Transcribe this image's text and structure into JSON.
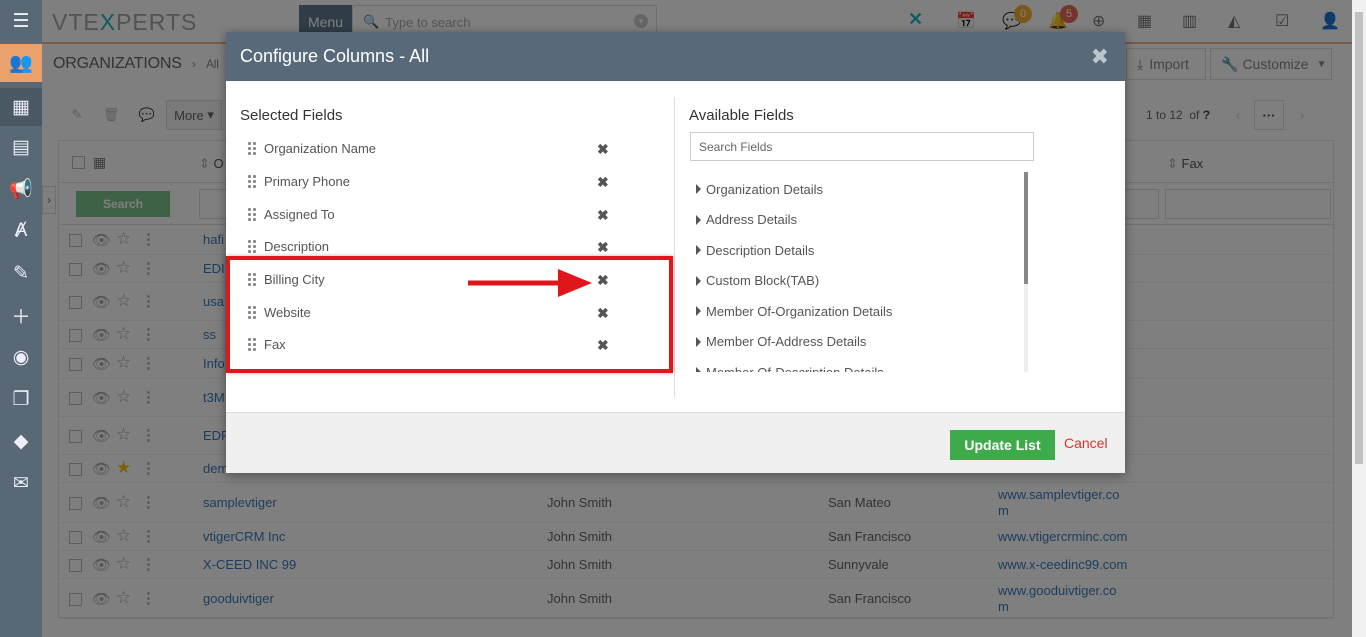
{
  "brand": {
    "logo_prefix": "VTE",
    "logo_x": "X",
    "logo_suffix": "PERTS"
  },
  "topbar": {
    "menu_label": "Menu",
    "search_placeholder": "Type to search",
    "chat_badge": "0",
    "notif_badge": "5",
    "icons": [
      "vtiger-x-icon",
      "tasks-icon",
      "chat-icon",
      "bell-icon",
      "plus-circle-icon",
      "calendar-icon",
      "bar-chart-icon",
      "area-chart-icon",
      "checkbox-icon",
      "user-icon"
    ]
  },
  "breadcrumb": {
    "module": "ORGANIZATIONS",
    "sep": "›",
    "filter": "All"
  },
  "header_buttons": {
    "import": "Import",
    "customize": "Customize"
  },
  "toolbar": {
    "more": "More",
    "pagination": "1 to 12",
    "of": "of",
    "total": "?",
    "dots": "···"
  },
  "list": {
    "columns_visible": [
      "O",
      "Fax"
    ],
    "search_label": "Search",
    "rows": [
      {
        "name": "hafi",
        "owner": "",
        "city": "",
        "website": "",
        "starred": false
      },
      {
        "name": "EDI",
        "owner": "",
        "city": "",
        "website": "",
        "starred": false
      },
      {
        "name": "usa",
        "owner": "",
        "city": "",
        "website": "",
        "starred": false
      },
      {
        "name": "ss",
        "owner": "",
        "city": "",
        "website": "",
        "starred": false
      },
      {
        "name": "Info",
        "owner": "",
        "city": "",
        "website": "",
        "starred": false
      },
      {
        "name": "t3M",
        "owner": "",
        "city": "",
        "website": "",
        "starred": false
      },
      {
        "name": "EDF",
        "owner": "",
        "city": "",
        "website": "",
        "starred": false
      },
      {
        "name": "dem",
        "owner": "",
        "city": "",
        "website": "",
        "starred": true
      },
      {
        "name": "samplevtiger",
        "owner": "John Smith",
        "city": "San Mateo",
        "website": "www.samplevtiger.co",
        "website2": "m",
        "starred": false
      },
      {
        "name": "vtigerCRM Inc",
        "owner": "John Smith",
        "city": "San Francisco",
        "website": "www.vtigercrminc.com",
        "starred": false
      },
      {
        "name": "X-CEED INC 99",
        "owner": "John Smith",
        "city": "Sunnyvale",
        "website": "www.x-ceedinc99.com",
        "starred": false
      },
      {
        "name": "gooduivtiger",
        "owner": "John Smith",
        "city": "San Francisco",
        "website": "www.gooduivtiger.co",
        "website2": "m",
        "starred": false
      }
    ]
  },
  "modal": {
    "title": "Configure Columns - All",
    "selected_title": "Selected Fields",
    "available_title": "Available Fields",
    "search_placeholder": "Search Fields",
    "selected_fields": [
      "Organization Name",
      "Primary Phone",
      "Assigned To",
      "Description",
      "Billing City",
      "Website",
      "Fax"
    ],
    "available_groups": [
      "Organization Details",
      "Address Details",
      "Description Details",
      "Custom Block(TAB)",
      "Member Of-Organization Details",
      "Member Of-Address Details",
      "Member Of-Description Details"
    ],
    "update_label": "Update List",
    "cancel_label": "Cancel"
  },
  "colors": {
    "accent_orange": "#eaa16b",
    "modal_header": "#586a7a",
    "update_green": "#3eab4a",
    "highlight_red": "#e0161c",
    "cancel_red": "#d9342b"
  }
}
